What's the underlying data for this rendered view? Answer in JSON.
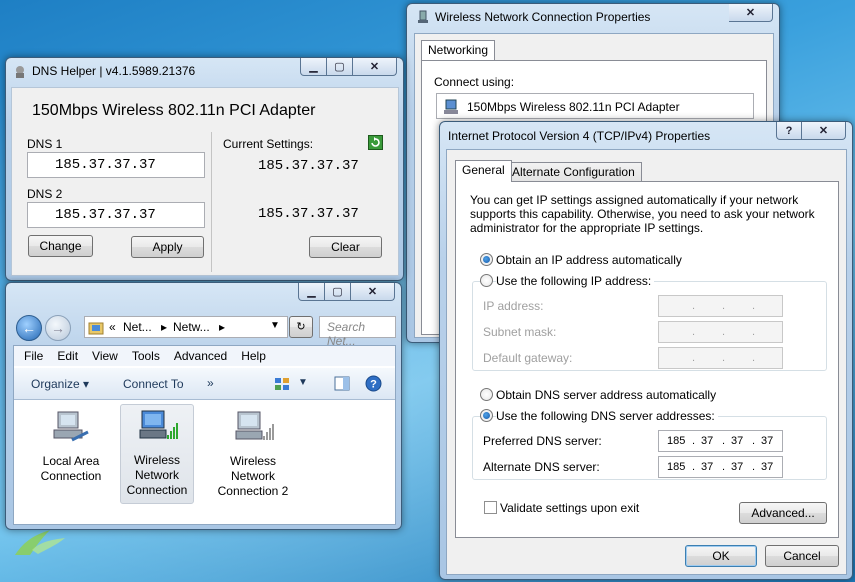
{
  "dns_helper": {
    "title": "DNS Helper | v4.1.5989.21376",
    "adapter": "150Mbps Wireless 802.11n PCI Adapter",
    "dns1_label": "DNS 1",
    "dns1_value": "185.37.37.37",
    "dns2_label": "DNS 2",
    "dns2_value": "185.37.37.37",
    "current_label": "Current Settings:",
    "current1": "185.37.37.37",
    "current2": "185.37.37.37",
    "change_label": "Change",
    "apply_label": "Apply",
    "clear_label": "Clear"
  },
  "explorer": {
    "breadcrumb": [
      "Net...",
      "Netw..."
    ],
    "search_placeholder": "Search Net...",
    "menu": [
      "File",
      "Edit",
      "View",
      "Tools",
      "Advanced",
      "Help"
    ],
    "organize_label": "Organize",
    "connect_to_label": "Connect To",
    "more_label": "»",
    "items": [
      {
        "label": "Local Area Connection"
      },
      {
        "label": "Wireless Network Connection"
      },
      {
        "label": "Wireless Network Connection 2"
      }
    ]
  },
  "wnc_props": {
    "title": "Wireless Network Connection Properties",
    "tab": "Networking",
    "connect_using_label": "Connect using:",
    "adapter": "150Mbps Wireless 802.11n PCI Adapter"
  },
  "ipv4": {
    "title": "Internet Protocol Version 4 (TCP/IPv4) Properties",
    "tab_general": "General",
    "tab_alternate": "Alternate Configuration",
    "intro": "You can get IP settings assigned automatically if your network supports this capability. Otherwise, you need to ask your network administrator for the appropriate IP settings.",
    "obtain_ip_auto": "Obtain an IP address automatically",
    "use_following_ip": "Use the following IP address:",
    "ip_address_label": "IP address:",
    "subnet_label": "Subnet mask:",
    "gateway_label": "Default gateway:",
    "obtain_dns_auto": "Obtain DNS server address automatically",
    "use_following_dns": "Use the following DNS server addresses:",
    "preferred_dns_label": "Preferred DNS server:",
    "alternate_dns_label": "Alternate DNS server:",
    "preferred_dns": [
      "185",
      "37",
      "37",
      "37"
    ],
    "alternate_dns": [
      "185",
      "37",
      "37",
      "37"
    ],
    "validate_label": "Validate settings upon exit",
    "advanced_label": "Advanced...",
    "ok_label": "OK",
    "cancel_label": "Cancel"
  },
  "colors": {
    "accent": "#3399ff",
    "desktop": "#2b8fd3"
  }
}
